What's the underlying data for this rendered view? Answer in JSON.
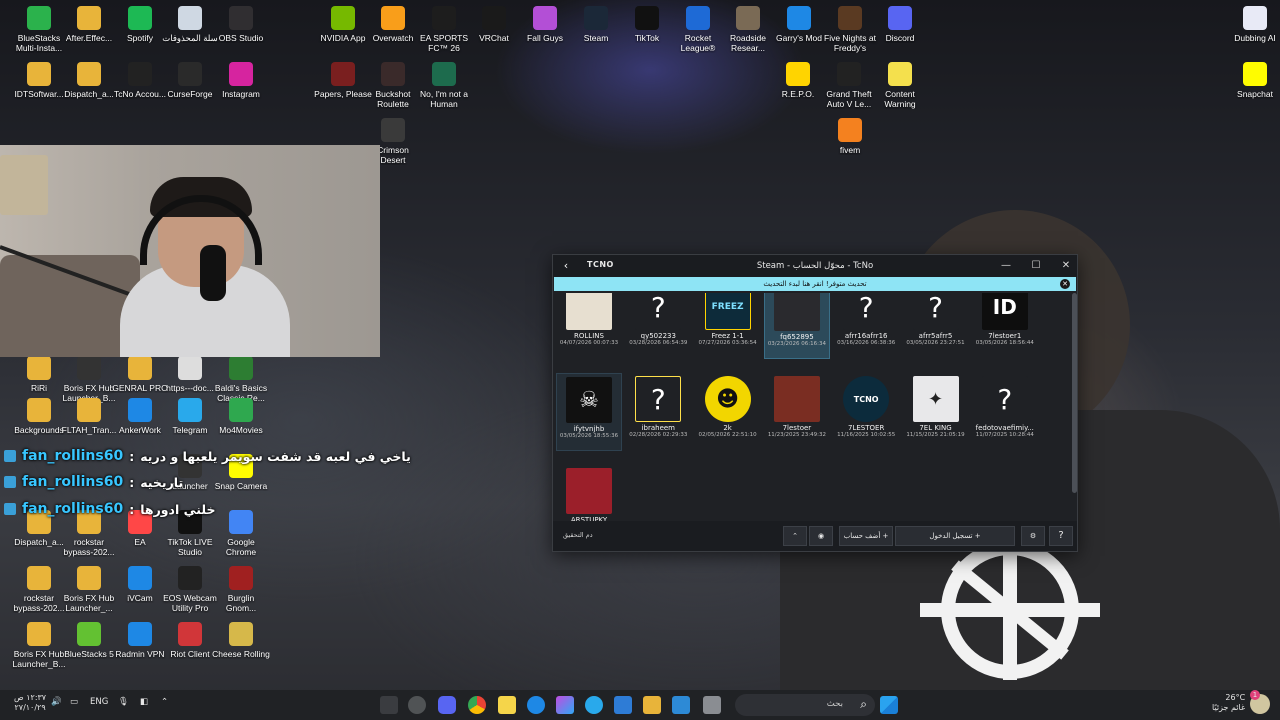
{
  "desktop_icons": [
    {
      "label": "BlueStacks Multi-Insta...",
      "icon": "bluestacks-icon",
      "color": "#2bb24c"
    },
    {
      "label": "After.Effec...",
      "icon": "folder-icon",
      "color": "#e8b43a"
    },
    {
      "label": "Spotify",
      "icon": "spotify-icon",
      "color": "#1db954"
    },
    {
      "label": "سلة المحذوفات",
      "icon": "recycle-bin-icon",
      "color": "#cfd8e3"
    },
    {
      "label": "OBS Studio",
      "icon": "obs-icon",
      "color": "#302e31"
    },
    {
      "label": "NVIDIA App",
      "icon": "nvidia-icon",
      "color": "#76b900"
    },
    {
      "label": "Overwatch",
      "icon": "overwatch-icon",
      "color": "#f99e1a"
    },
    {
      "label": "EA SPORTS FC™ 26",
      "icon": "ea-fc-icon",
      "color": "#1d1d1d"
    },
    {
      "label": "VRChat",
      "icon": "vrchat-icon",
      "color": "#1a1a1a"
    },
    {
      "label": "Fall Guys",
      "icon": "fallguys-icon",
      "color": "#b34fd6"
    },
    {
      "label": "Steam",
      "icon": "steam-icon",
      "color": "#1b2838"
    },
    {
      "label": "TikTok",
      "icon": "tiktok-icon",
      "color": "#111111"
    },
    {
      "label": "Rocket League®",
      "icon": "rocket-league-icon",
      "color": "#1e6ad6"
    },
    {
      "label": "Roadside Resear...",
      "icon": "roadside-icon",
      "color": "#7a6a55"
    },
    {
      "label": "Garry's Mod",
      "icon": "gmod-icon",
      "color": "#1e88e5"
    },
    {
      "label": "Five Nights at Freddy's",
      "icon": "fnaf-icon",
      "color": "#5a3a22"
    },
    {
      "label": "Discord",
      "icon": "discord-icon",
      "color": "#5865f2"
    },
    {
      "label": "Dubbing AI",
      "icon": "dubbing-ai-icon",
      "color": "#e8eaf6"
    },
    {
      "label": "IDTSoftwar...",
      "icon": "folder-icon",
      "color": "#e8b43a"
    },
    {
      "label": "Dispatch_a...",
      "icon": "folder-icon",
      "color": "#e8b43a"
    },
    {
      "label": "TcNo Accou...",
      "icon": "tcno-icon",
      "color": "#222"
    },
    {
      "label": "CurseForge",
      "icon": "curseforge-icon",
      "color": "#2a2a2a"
    },
    {
      "label": "Instagram",
      "icon": "instagram-icon",
      "color": "#d6249f"
    },
    {
      "label": "Papers, Please",
      "icon": "papers-please-icon",
      "color": "#7a1f1f"
    },
    {
      "label": "Buckshot Roulette",
      "icon": "buckshot-icon",
      "color": "#3a2a2a"
    },
    {
      "label": "No, I'm not a Human",
      "icon": "not-human-icon",
      "color": "#1d6b4d"
    },
    {
      "label": "R.E.P.O.",
      "icon": "repo-icon",
      "color": "#ffd400"
    },
    {
      "label": "Grand Theft Auto V Le...",
      "icon": "gta-icon",
      "color": "#222"
    },
    {
      "label": "Content Warning",
      "icon": "content-warning-icon",
      "color": "#f4e04d"
    },
    {
      "label": "Snapchat",
      "icon": "snapchat-icon",
      "color": "#fffc00"
    },
    {
      "label": "Crimson Desert",
      "icon": "crimson-desert-icon",
      "color": "#3a3a3a"
    },
    {
      "label": "fivem",
      "icon": "fivem-icon",
      "color": "#f4811f"
    },
    {
      "label": "RiRi",
      "icon": "folder-icon",
      "color": "#e8b43a"
    },
    {
      "label": "Boris FX Hub Launcher_B...",
      "icon": "borisfx-icon",
      "color": "#333"
    },
    {
      "label": "GENRAL PRO",
      "icon": "folder-icon",
      "color": "#e8b43a"
    },
    {
      "label": "https---doc...",
      "icon": "file-icon",
      "color": "#ddd"
    },
    {
      "label": "Baldi's Basics Classic Re...",
      "icon": "baldi-icon",
      "color": "#2d7d32"
    },
    {
      "label": "Backgrounds",
      "icon": "folder-icon",
      "color": "#e8b43a"
    },
    {
      "label": "FLTAH_Tran...",
      "icon": "folder-icon",
      "color": "#e8b43a"
    },
    {
      "label": "AnkerWork",
      "icon": "ankerwork-icon",
      "color": "#1e88e5"
    },
    {
      "label": "Telegram",
      "icon": "telegram-icon",
      "color": "#29a9eb"
    },
    {
      "label": "Mo4Movies",
      "icon": "mo4movies-icon",
      "color": "#2fa84f"
    },
    {
      "label": "Launcher",
      "icon": "launcher-icon",
      "color": "#333"
    },
    {
      "label": "Snap Camera",
      "icon": "snap-camera-icon",
      "color": "#fffc00"
    },
    {
      "label": "Dispatch_a...",
      "icon": "folder-icon",
      "color": "#e8b43a"
    },
    {
      "label": "rockstar bypass-202...",
      "icon": "folder-icon",
      "color": "#e8b43a"
    },
    {
      "label": "EA",
      "icon": "ea-icon",
      "color": "#ff4747"
    },
    {
      "label": "TikTok LIVE Studio",
      "icon": "tiktok-live-icon",
      "color": "#111"
    },
    {
      "label": "Google Chrome",
      "icon": "chrome-icon",
      "color": "#4285f4"
    },
    {
      "label": "rockstar bypass-202...",
      "icon": "folder-icon",
      "color": "#e8b43a"
    },
    {
      "label": "Boris FX Hub Launcher_...",
      "icon": "folder-icon",
      "color": "#e8b43a"
    },
    {
      "label": "iVCam",
      "icon": "ivcam-icon",
      "color": "#1e88e5"
    },
    {
      "label": "EOS Webcam Utility Pro",
      "icon": "eos-webcam-icon",
      "color": "#222"
    },
    {
      "label": "Burglin Gnom...",
      "icon": "burglin-icon",
      "color": "#a02020"
    },
    {
      "label": "Boris FX Hub Launcher_B...",
      "icon": "folder-icon",
      "color": "#e8b43a"
    },
    {
      "label": "BlueStacks 5",
      "icon": "bluestacks5-icon",
      "color": "#63c132"
    },
    {
      "label": "Radmin VPN",
      "icon": "radmin-icon",
      "color": "#1e88e5"
    },
    {
      "label": "Riot Client",
      "icon": "riot-icon",
      "color": "#d13639"
    },
    {
      "label": "Cheese Rolling",
      "icon": "cheese-rolling-icon",
      "color": "#d6b84a"
    }
  ],
  "chat": [
    {
      "user": "fan_rollins60",
      "sep": ":",
      "message": "ياخي في لعبه قد شفت سويمر يلعبها و دريه"
    },
    {
      "user": "fan_rollins60",
      "sep": ":",
      "message": "تاريخيه"
    },
    {
      "user": "fan_rollins60",
      "sep": ":",
      "message": "خلني ادورها"
    }
  ],
  "window": {
    "brand": "TCNO",
    "title": "Steam - محوّل الحساب - TcNo",
    "minimize": "—",
    "maximize": "☐",
    "close": "✕",
    "banner": "تحديث متوفر! انقر هنا لبدء التحديث",
    "banner_close": "✕",
    "accounts": [
      {
        "name": "ROLLINS",
        "time": "04/07/2026 00:07:33",
        "avatar": "roll",
        "state": "normal"
      },
      {
        "name": "qy502233",
        "time": "03/28/2026 06:54:39",
        "avatar": "?",
        "state": "normal"
      },
      {
        "name": "Freez 1-1",
        "time": "07/27/2026 03:36:54",
        "avatar": "FREEZ",
        "state": "normal"
      },
      {
        "name": "fq652895",
        "time": "03/23/2026 06:16:34",
        "avatar": "dark",
        "state": "selected"
      },
      {
        "name": "afrr16afrr16",
        "time": "03/16/2026 06:38:36",
        "avatar": "?",
        "state": "normal"
      },
      {
        "name": "afrr5afrr5",
        "time": "03/05/2026 23:27:51",
        "avatar": "?",
        "state": "normal"
      },
      {
        "name": "7lestoer1",
        "time": "03/05/2026 18:56:44",
        "avatar": "ID",
        "state": "normal"
      },
      {
        "name": "ifytvnjhb",
        "time": "03/05/2026 18:55:36",
        "avatar": "skull",
        "state": "alt"
      },
      {
        "name": "ibraheem",
        "time": "02/28/2026 02:29:33",
        "avatar": "?",
        "state": "hover"
      },
      {
        "name": "2k",
        "time": "02/05/2026 22:51:10",
        "avatar": "face",
        "state": "normal"
      },
      {
        "name": "7lestoer",
        "time": "11/23/2025 23:49:32",
        "avatar": "warrior",
        "state": "normal"
      },
      {
        "name": "7LESTOER",
        "time": "11/16/2025 10:02:55",
        "avatar": "TCNO",
        "state": "normal"
      },
      {
        "name": "7EL KING",
        "time": "11/15/2025 21:05:19",
        "avatar": "anime",
        "state": "normal"
      },
      {
        "name": "fedotovaefimiy...",
        "time": "11/07/2025 10:28:44",
        "avatar": "?",
        "state": "normal"
      },
      {
        "name": "ARSTUPKY",
        "time": "",
        "avatar": "red",
        "state": "normal"
      }
    ],
    "bottom": {
      "hint": "دم التحقيق",
      "add_account": "أضف حساب +",
      "login": "تسجيل الدخول +",
      "help": "?"
    }
  },
  "taskbar": {
    "time": "١٢:٣٧ ص",
    "date": "٢٧/١٠/٢٩",
    "lang": "ENG",
    "search_placeholder": "بحث",
    "weather_temp": "26°C",
    "weather_desc": "غائم جزئيًا",
    "notification_count": "1"
  }
}
